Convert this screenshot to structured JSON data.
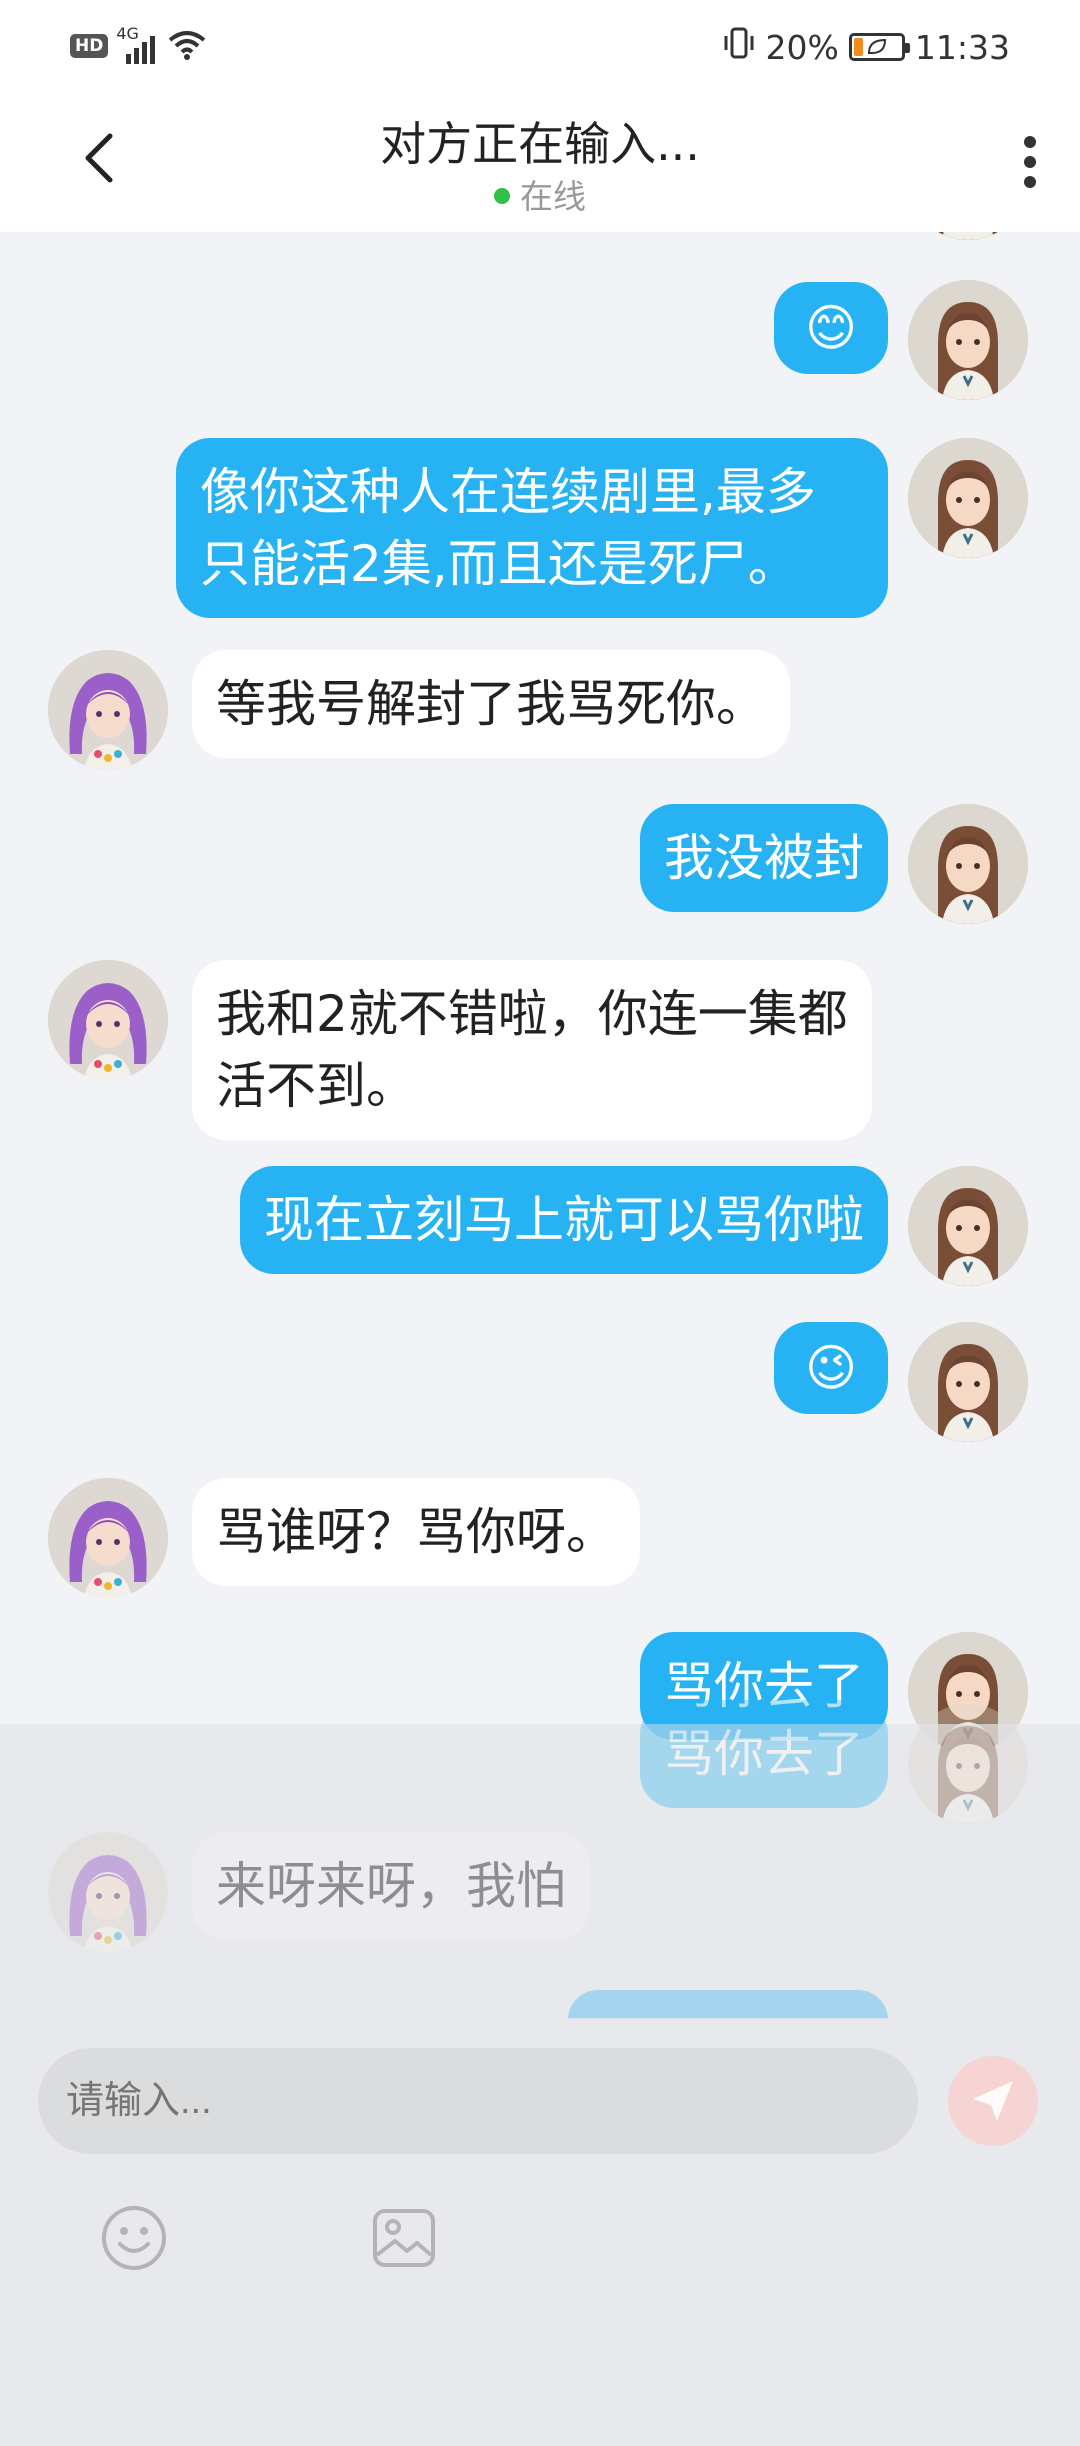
{
  "status_bar": {
    "hd": "HD",
    "network": "4G",
    "battery": "20%",
    "battery_level": 0.2,
    "time": "11:33"
  },
  "header": {
    "title": "对方正在输入...",
    "status": "在线",
    "status_color": "#2fc04a"
  },
  "messages": [
    {
      "from": "me",
      "text": "😊"
    },
    {
      "from": "me",
      "text": "像你这种人在连续剧里,最多只能活2集,而且还是死尸。"
    },
    {
      "from": "them",
      "text": "等我号解封了我骂死你。"
    },
    {
      "from": "me",
      "text": "我没被封"
    },
    {
      "from": "them",
      "text": "我和2就不错啦，你连一集都活不到。"
    },
    {
      "from": "me",
      "text": "现在立刻马上就可以骂你啦"
    },
    {
      "from": "me",
      "text": "😉"
    },
    {
      "from": "them",
      "text": "骂谁呀？骂你呀。"
    },
    {
      "from": "me",
      "text": "骂你去了"
    }
  ],
  "ghost_messages": [
    {
      "from": "me",
      "text": "骂你去了"
    },
    {
      "from": "them",
      "text": "来呀来呀，我怕"
    }
  ],
  "composer": {
    "placeholder": "请输入...",
    "emoji_icon": "smiley-face-icon",
    "image_icon": "image-icon",
    "send_icon": "paper-plane-icon"
  },
  "colors": {
    "my_bubble": "#27b3f3",
    "their_bubble": "#ffffff",
    "background": "#f1f3f7"
  }
}
